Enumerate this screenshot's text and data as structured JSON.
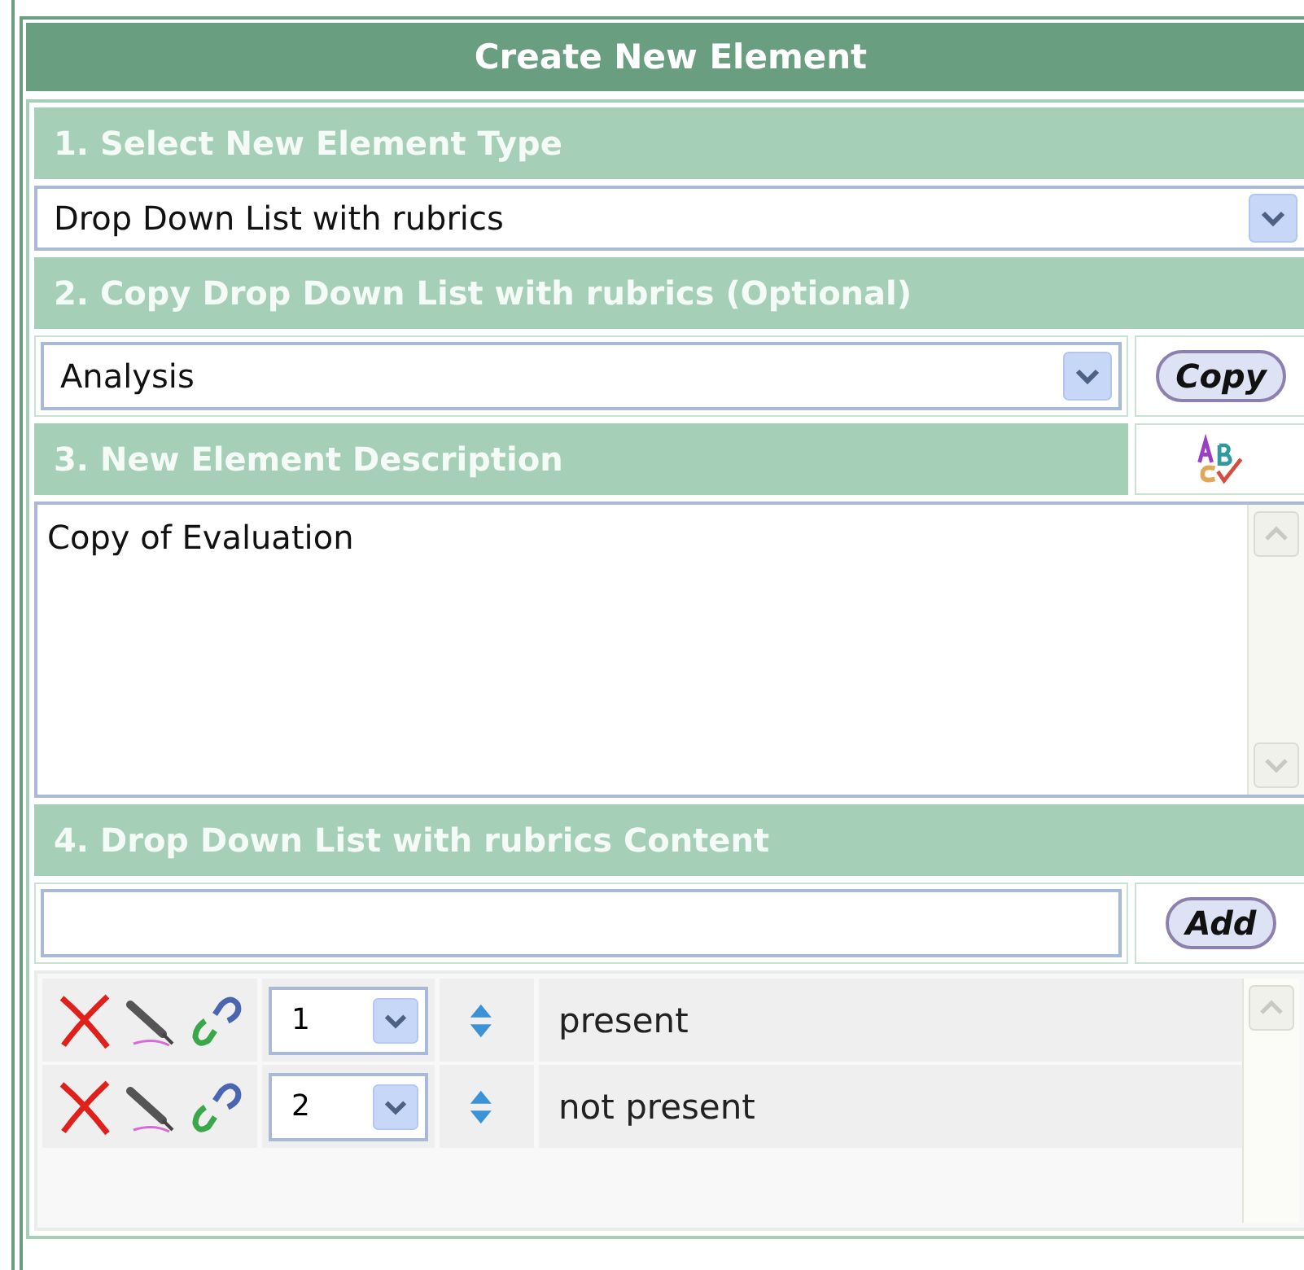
{
  "title": "Create New Element",
  "type_header": "1. Select New Element Type",
  "type_select": {
    "value": "Drop Down List with rubrics"
  },
  "copy_header": "2. Copy Drop Down List with rubrics (Optional)",
  "copy_select": {
    "value": "Analysis"
  },
  "copy_button": "Copy",
  "description_header": "3. New Element Description",
  "description": {
    "value": "Copy of Evaluation"
  },
  "content_header": "4. Drop Down List with rubrics Content",
  "add_button": "Add",
  "items": [
    {
      "order": "1",
      "text": "present"
    },
    {
      "order": "2",
      "text": "not present"
    }
  ]
}
